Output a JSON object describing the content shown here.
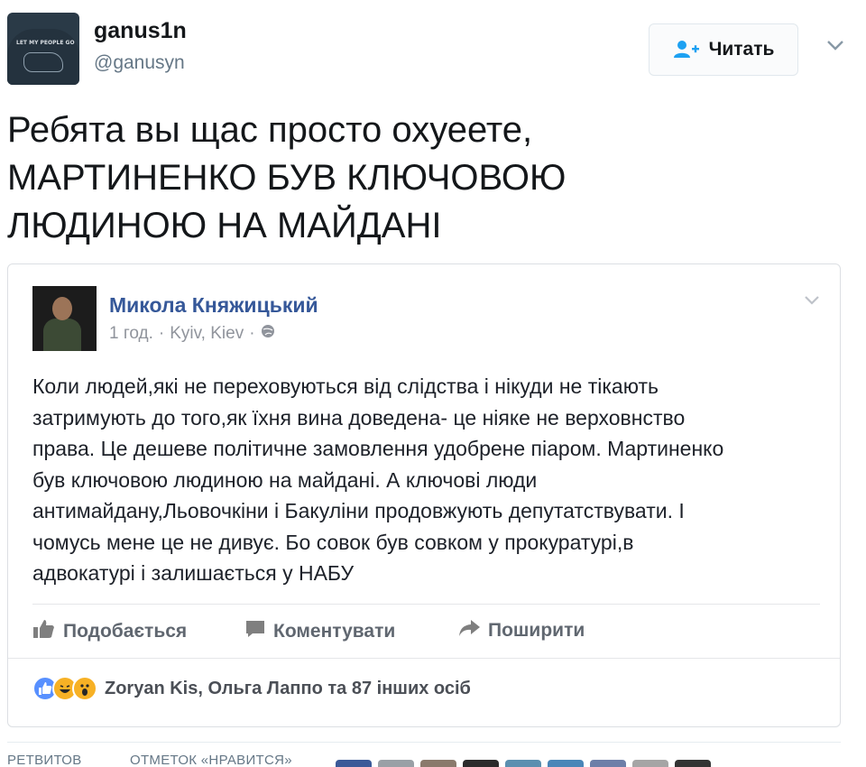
{
  "author": {
    "display_name": "ganus1n",
    "handle": "@ganusyn",
    "avatar_caption": "LET MY PEOPLE GO"
  },
  "follow_button": {
    "label": "Читать",
    "icon": "follow-person-plus-icon"
  },
  "tweet": {
    "text_lines": [
      "Ребята вы щас просто охуеете,",
      "МАРТИНЕНКО БУВ КЛЮЧОВОЮ",
      "ЛЮДИНОЮ НА МАЙДАНІ"
    ]
  },
  "embedded_post": {
    "author": "Микола Княжицький",
    "time": "1 год.",
    "location": "Kyiv, Kiev",
    "privacy_icon": "globe-icon",
    "body_lines": [
      "Коли людей,які не переховуються від слідства і нікуди не тікають",
      "затримують до того,як їхня вина доведена- це ніяке не верховнство",
      "права. Це дешеве політичне замовлення удобрене піаром. Мартиненко",
      "був ключовою людиною на майдані. А ключові люди",
      "антимайдану,Льовочкіни і Бакуліни продовжують депутатствувати. І",
      "чомусь мене це не дивує. Бо совок був совком у прокуратурі,в",
      "адвокатурі і залишається у НАБУ"
    ],
    "actions": {
      "like": "Подобається",
      "comment": "Коментувати",
      "share": "Поширити"
    },
    "reactions_text": "Zoryan Kis, Ольга Лаппо та 87 інших осіб"
  },
  "stats": {
    "retweets_label": "РЕТВИТОВ",
    "likes_label": "ОТМЕТОК «НРАВИТСЯ»"
  },
  "colors": {
    "twitter_text": "#14171a",
    "twitter_secondary": "#657786",
    "facebook_link": "#365899",
    "facebook_action": "#606770"
  }
}
